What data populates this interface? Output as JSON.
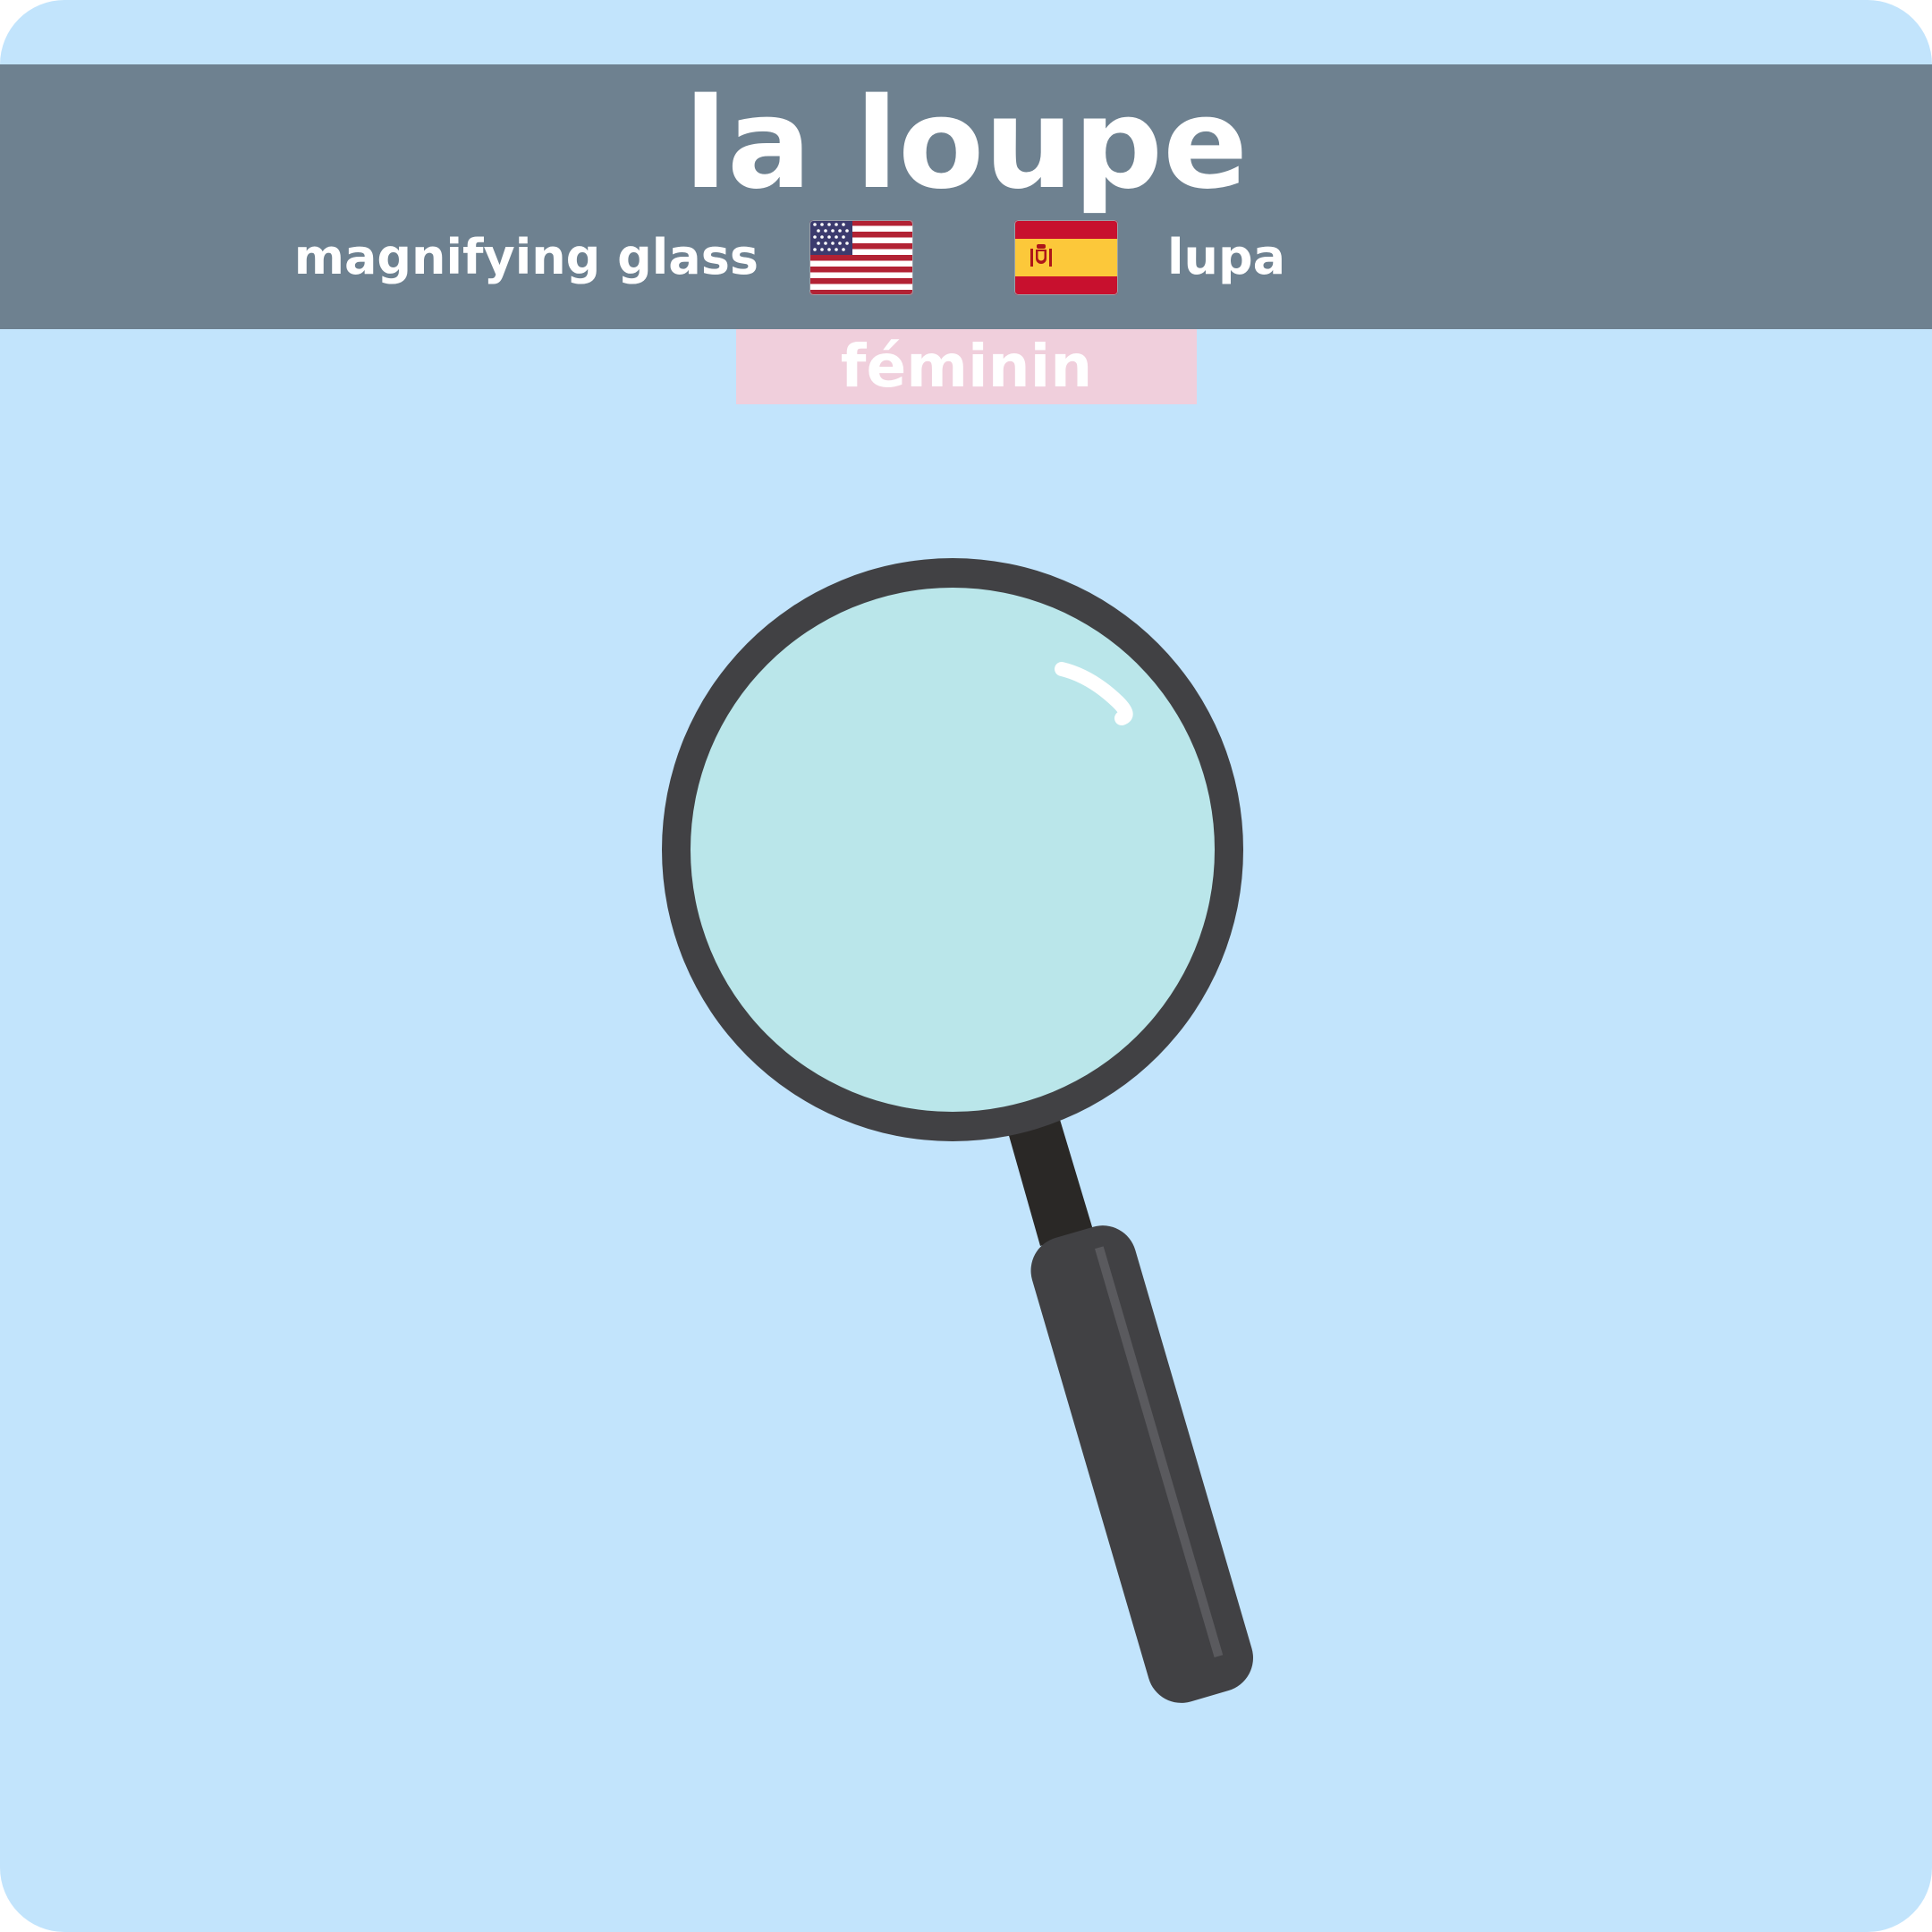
{
  "card": {
    "background_color": "#c2e4fc",
    "header_color": "#6e8190"
  },
  "word": {
    "french": "la loupe",
    "gender": "féminin",
    "gender_color": "#f0cfdc"
  },
  "translations": {
    "english": "magnifying glass",
    "spanish": "lupa"
  },
  "icons": {
    "english_flag": "us-flag-icon",
    "spanish_flag": "spain-flag-icon",
    "illustration": "magnifying-glass-icon"
  },
  "illustration_colors": {
    "lens": "#bae6ea",
    "rim": "#414144",
    "stem": "#2a2826",
    "handle": "#414144",
    "handle_highlight": "#5a5a5e",
    "glare": "#ffffff"
  }
}
